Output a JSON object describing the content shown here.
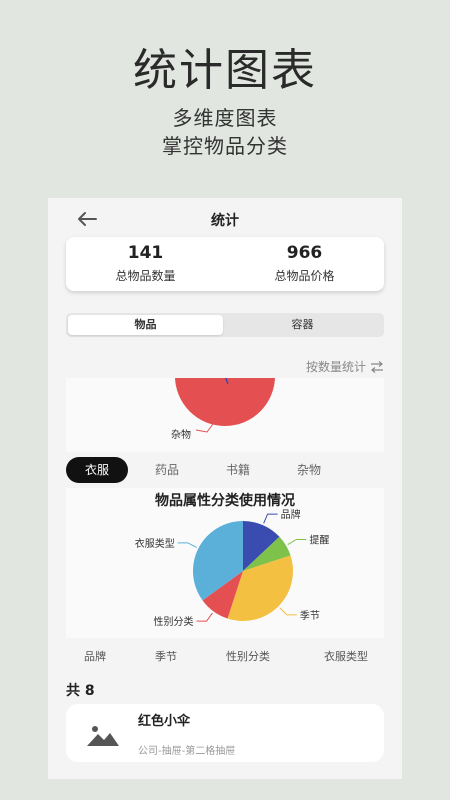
{
  "hero": {
    "title": "统计图表",
    "subtitle1": "多维度图表",
    "subtitle2": "掌控物品分类"
  },
  "nav": {
    "back_icon": "arrow-left-icon",
    "title": "统计"
  },
  "stats": {
    "total_count_value": "141",
    "total_count_label": "总物品数量",
    "total_price_value": "966",
    "total_price_label": "总物品价格"
  },
  "segment": {
    "items_label": "物品",
    "containers_label": "容器"
  },
  "mode_toggle": {
    "label": "按数量统计",
    "icon": "swap-arrows-icon"
  },
  "pie1": {
    "visible_slice_label": "杂物",
    "slice_color": "#e45052"
  },
  "category_tabs": [
    "衣服",
    "药品",
    "书籍",
    "杂物"
  ],
  "chart_data": {
    "type": "pie",
    "title": "物品属性分类使用情况",
    "categories": [
      "品牌",
      "提醒",
      "季节",
      "性别分类",
      "衣服类型"
    ],
    "values": [
      13,
      7,
      35,
      10,
      35
    ],
    "colors": [
      "#3a4cb0",
      "#7ec24c",
      "#f4c042",
      "#e45052",
      "#5ab0d8"
    ]
  },
  "attr_labels": [
    "品牌",
    "季节",
    "性别分类",
    "衣服类型"
  ],
  "list": {
    "count_label": "共 8",
    "item": {
      "name": "红色小伞",
      "location": "公司-抽屉-第二格抽屉",
      "thumbnail_icon": "image-placeholder-icon"
    }
  }
}
